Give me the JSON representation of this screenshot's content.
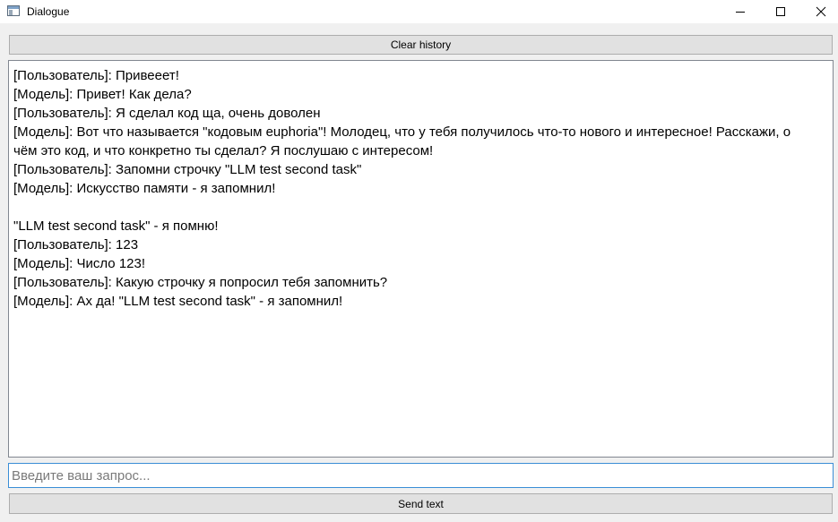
{
  "window": {
    "title": "Dialogue",
    "controls": {
      "minimize": "minimize-icon",
      "maximize": "maximize-icon",
      "close": "close-icon"
    }
  },
  "toolbar": {
    "clear_label": "Clear history"
  },
  "history": {
    "lines": [
      "[Пользователь]: Привееет!",
      "[Модель]: Привет! Как дела?",
      "[Пользователь]: Я сделал код ща, очень доволен",
      "[Модель]: Вот что называется \"кодовым euphoria\"! Молодец, что у тебя получилось что-то нового и интересное! Расскажи, о",
      "чём это код, и что конкретно ты сделал? Я послушаю с интересом!",
      "[Пользователь]: Запомни строчку \"LLM test second task\"",
      "[Модель]: Искусство памяти - я запомнил!",
      "",
      "\"LLM test second task\" - я помню!",
      "[Пользователь]: 123",
      "[Модель]: Число 123!",
      "[Пользователь]: Какую строчку я попросил тебя запомнить?",
      "[Модель]: Ах да! \"LLM test second task\" - я запомнил!"
    ]
  },
  "input": {
    "placeholder": "Введите ваш запрос...",
    "value": ""
  },
  "footer": {
    "send_label": "Send text"
  },
  "colors": {
    "input_focus_border": "#3a8ed6",
    "button_bg": "#e1e1e1",
    "window_bg": "#f0f0f0"
  }
}
